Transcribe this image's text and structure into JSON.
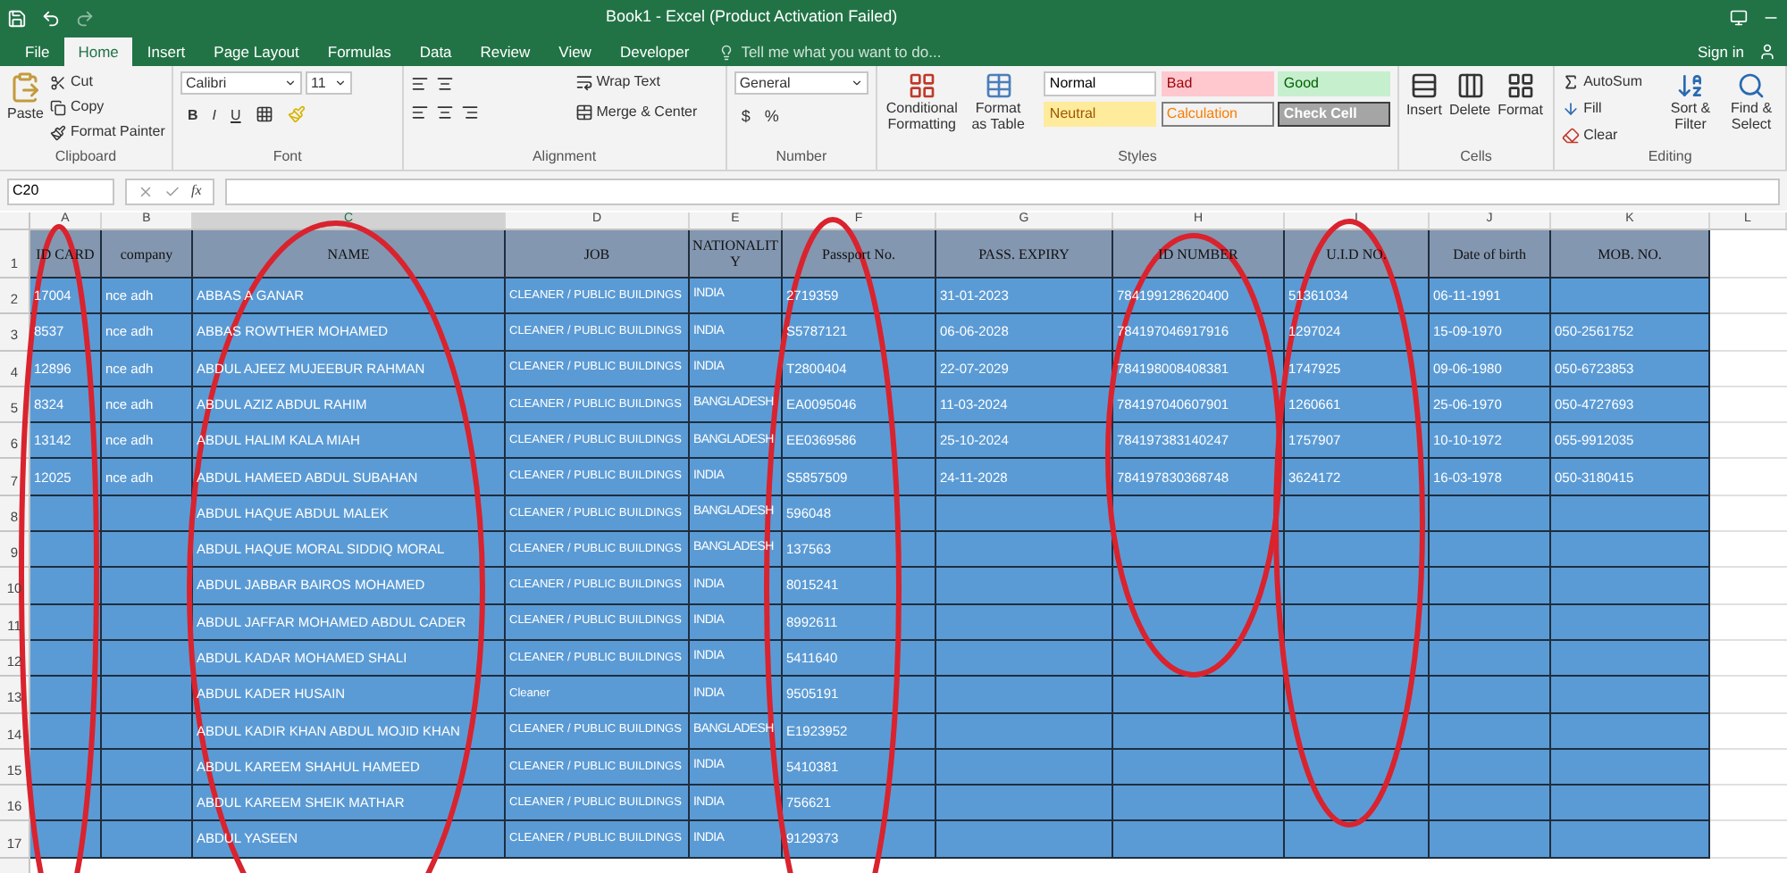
{
  "window": {
    "title": "Book1 - Excel (Product Activation Failed)"
  },
  "tabs": [
    {
      "label": "File",
      "selected": false
    },
    {
      "label": "Home",
      "selected": true
    },
    {
      "label": "Insert",
      "selected": false
    },
    {
      "label": "Page Layout",
      "selected": false
    },
    {
      "label": "Formulas",
      "selected": false
    },
    {
      "label": "Data",
      "selected": false
    },
    {
      "label": "Review",
      "selected": false
    },
    {
      "label": "View",
      "selected": false
    },
    {
      "label": "Developer",
      "selected": false
    }
  ],
  "tell_me": {
    "placeholder": "Tell me what you want to do..."
  },
  "sign_in": "Sign in",
  "ribbon": {
    "clipboard": {
      "label": "Clipboard",
      "paste": "Paste",
      "cut": "Cut",
      "copy": "Copy",
      "format_painter": "Format Painter"
    },
    "font": {
      "label": "Font",
      "font_name": "Calibri",
      "font_size": "11",
      "bold": "B",
      "italic": "I",
      "underline": "U"
    },
    "alignment": {
      "label": "Alignment",
      "wrap_text": "Wrap Text",
      "merge": "Merge & Center"
    },
    "number": {
      "label": "Number",
      "format": "General",
      "currency": "$",
      "percent": "%"
    },
    "styles": {
      "label": "Styles",
      "conditional": "Conditional Formatting",
      "format_table": "Format as Table",
      "gallery": [
        {
          "label": "Normal",
          "kind": "normal"
        },
        {
          "label": "Bad",
          "kind": "bad"
        },
        {
          "label": "Good",
          "kind": "good"
        },
        {
          "label": "Neutral",
          "kind": "neutral"
        },
        {
          "label": "Calculation",
          "kind": "calculation"
        },
        {
          "label": "Check Cell",
          "kind": "check"
        }
      ]
    },
    "cells": {
      "label": "Cells",
      "buttons": [
        "Insert",
        "Delete",
        "Format"
      ]
    },
    "editing": {
      "label": "Editing",
      "autosum": "AutoSum",
      "fill": "Fill",
      "clear": "Clear",
      "sort": "Sort & Filter",
      "find": "Find & Select"
    }
  },
  "formula_bar": {
    "name_box": "C20",
    "fx": "fx"
  },
  "table": {
    "columns": [
      {
        "letter": "A",
        "heading": "ID CARD",
        "selected": false
      },
      {
        "letter": "B",
        "heading": "company",
        "selected": false
      },
      {
        "letter": "C",
        "heading": "NAME",
        "selected": true
      },
      {
        "letter": "D",
        "heading": "JOB",
        "selected": false
      },
      {
        "letter": "E",
        "heading": "NATIONALITY",
        "selected": false
      },
      {
        "letter": "F",
        "heading": "Passport No.",
        "selected": false
      },
      {
        "letter": "G",
        "heading": "PASS. EXPIRY",
        "selected": false
      },
      {
        "letter": "H",
        "heading": "ID NUMBER",
        "selected": false
      },
      {
        "letter": "I",
        "heading": "U.I.D NO.",
        "selected": false
      },
      {
        "letter": "J",
        "heading": "Date of birth",
        "selected": false
      },
      {
        "letter": "K",
        "heading": "MOB. NO.",
        "selected": false
      },
      {
        "letter": "L",
        "selected": false
      }
    ],
    "header_row": "1",
    "rows": [
      {
        "number": "2",
        "cells": {
          "A": "17004",
          "B": "nce adh",
          "C": "ABBAS A GANAR",
          "D": "CLEANER / PUBLIC BUILDINGS",
          "E": "INDIA",
          "F": "2719359",
          "G": "31-01-2023",
          "H": "784199128620400",
          "I": "51361034",
          "J": "06-11-1991"
        }
      },
      {
        "number": "3",
        "cells": {
          "A": "8537",
          "B": "nce adh",
          "C": "ABBAS ROWTHER MOHAMED",
          "D": "CLEANER / PUBLIC BUILDINGS",
          "E": "INDIA",
          "F": "S5787121",
          "G": "06-06-2028",
          "H": "784197046917916",
          "I": "1297024",
          "J": "15-09-1970",
          "K": "050-2561752"
        }
      },
      {
        "number": "4",
        "cells": {
          "A": "12896",
          "B": "nce adh",
          "C": "ABDUL AJEEZ MUJEEBUR RAHMAN",
          "D": "CLEANER / PUBLIC BUILDINGS",
          "E": "INDIA",
          "F": "T2800404",
          "G": "22-07-2029",
          "H": "784198008408381",
          "I": "1747925",
          "J": "09-06-1980",
          "K": "050-6723853"
        }
      },
      {
        "number": "5",
        "cells": {
          "A": "8324",
          "B": "nce adh",
          "C": "ABDUL AZIZ ABDUL RAHIM",
          "D": "CLEANER / PUBLIC BUILDINGS",
          "E": "BANGLADESH",
          "F": "EA0095046",
          "G": "11-03-2024",
          "H": "784197040607901",
          "I": "1260661",
          "J": "25-06-1970",
          "K": "050-4727693"
        }
      },
      {
        "number": "6",
        "cells": {
          "A": "13142",
          "B": "nce adh",
          "C": "ABDUL HALIM KALA MIAH",
          "D": "CLEANER / PUBLIC BUILDINGS",
          "E": "BANGLADESH",
          "F": "EE0369586",
          "G": "25-10-2024",
          "H": "784197383140247",
          "I": "1757907",
          "J": "10-10-1972",
          "K": "055-9912035"
        }
      },
      {
        "number": "7",
        "cells": {
          "A": "12025",
          "B": "nce adh",
          "C": "ABDUL HAMEED ABDUL SUBAHAN",
          "D": "CLEANER / PUBLIC BUILDINGS",
          "E": "INDIA",
          "F": "S5857509",
          "G": "24-11-2028",
          "H": "784197830368748",
          "I": "3624172",
          "J": "16-03-1978",
          "K": "050-3180415"
        }
      },
      {
        "number": "8",
        "cells": {
          "C": "ABDUL HAQUE ABDUL MALEK",
          "D": "CLEANER / PUBLIC BUILDINGS",
          "E": "BANGLADESH",
          "F": "596048"
        }
      },
      {
        "number": "9",
        "cells": {
          "C": "ABDUL HAQUE MORAL SIDDIQ MORAL",
          "D": "CLEANER / PUBLIC BUILDINGS",
          "E": "BANGLADESH",
          "F": "137563"
        }
      },
      {
        "number": "10",
        "cells": {
          "C": "ABDUL JABBAR BAIROS MOHAMED",
          "D": "CLEANER / PUBLIC BUILDINGS",
          "E": "INDIA",
          "F": "8015241"
        }
      },
      {
        "number": "11",
        "cells": {
          "C": "ABDUL JAFFAR MOHAMED ABDUL CADER",
          "D": "CLEANER / PUBLIC BUILDINGS",
          "E": "INDIA",
          "F": "8992611"
        }
      },
      {
        "number": "12",
        "cells": {
          "C": "ABDUL KADAR MOHAMED SHALI",
          "D": "CLEANER / PUBLIC BUILDINGS",
          "E": "INDIA",
          "F": "5411640"
        }
      },
      {
        "number": "13",
        "cells": {
          "C": "ABDUL KADER HUSAIN",
          "D": "Cleaner",
          "E": "INDIA",
          "F": "9505191"
        }
      },
      {
        "number": "14",
        "cells": {
          "C": "ABDUL KADIR KHAN ABDUL MOJID KHAN",
          "D": "CLEANER / PUBLIC BUILDINGS",
          "E": "BANGLADESH",
          "F": "E1923952"
        }
      },
      {
        "number": "15",
        "cells": {
          "C": "ABDUL KAREEM SHAHUL HAMEED",
          "D": "CLEANER / PUBLIC BUILDINGS",
          "E": "INDIA",
          "F": "5410381"
        }
      },
      {
        "number": "16",
        "cells": {
          "C": "ABDUL KAREEM SHEIK MATHAR",
          "D": "CLEANER / PUBLIC BUILDINGS",
          "E": "INDIA",
          "F": "756621"
        }
      },
      {
        "number": "17",
        "cells": {
          "C": "ABDUL YASEEN",
          "D": "CLEANER / PUBLIC BUILDINGS",
          "E": "INDIA",
          "F": "9129373"
        }
      }
    ]
  }
}
